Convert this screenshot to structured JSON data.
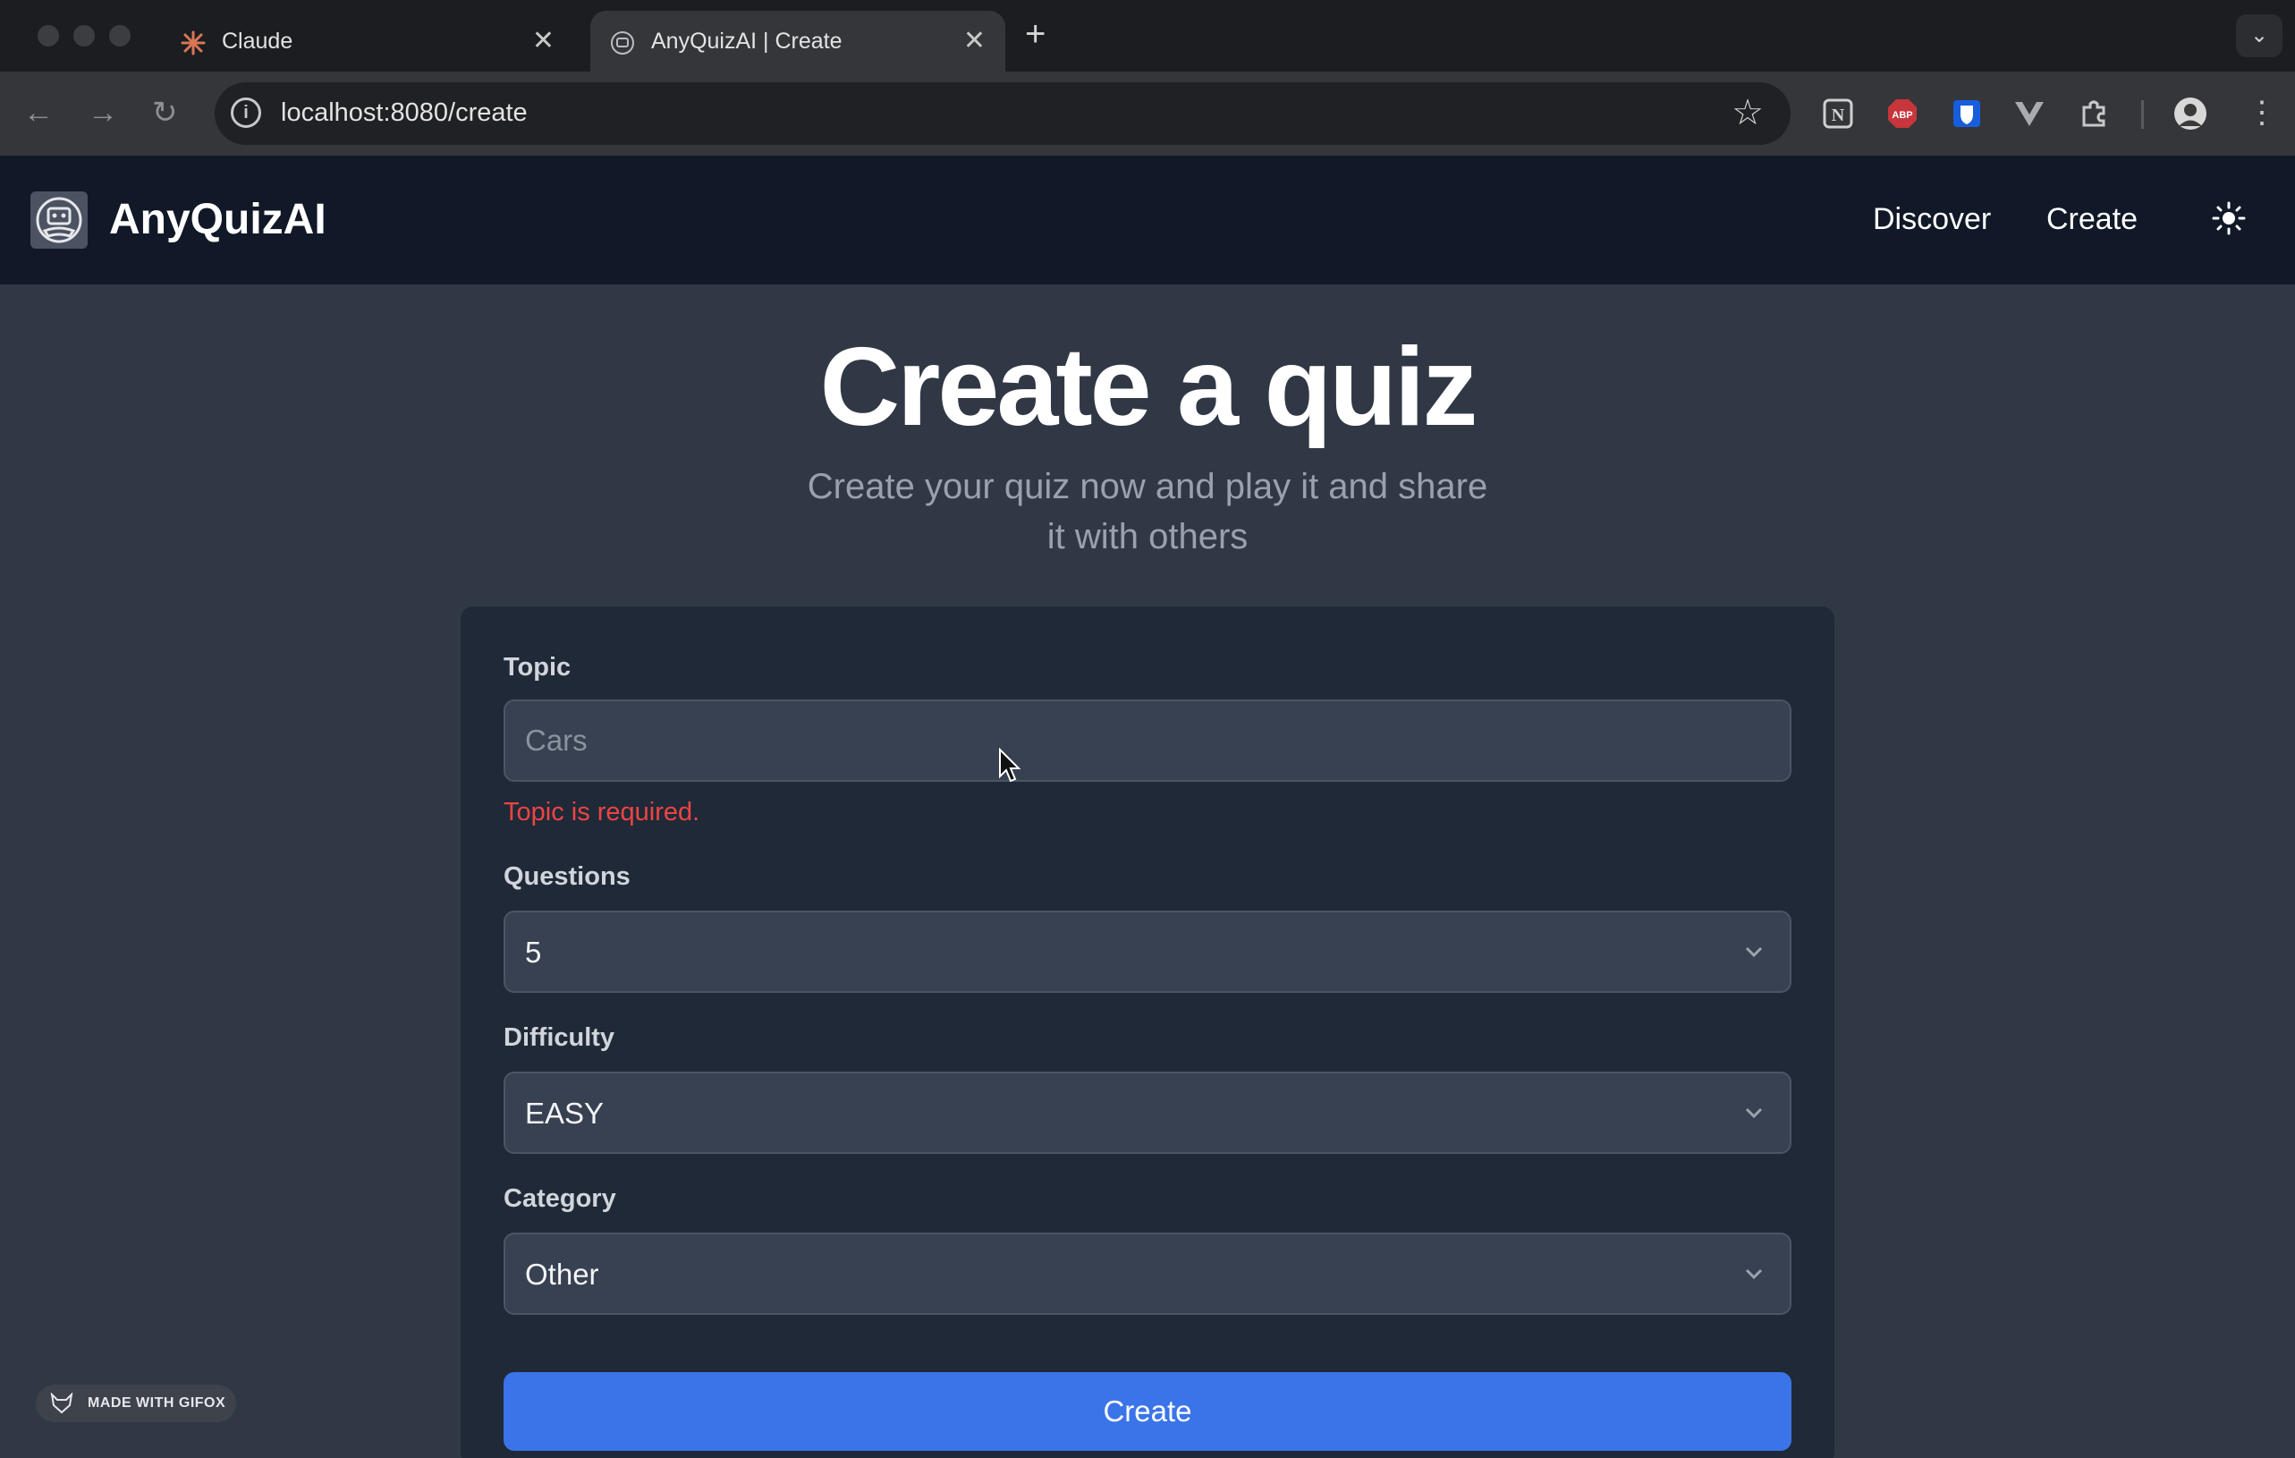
{
  "browser": {
    "tabs": [
      {
        "title": "Claude",
        "icon": "claude-sparkle-icon",
        "active": false
      },
      {
        "title": "AnyQuizAI | Create",
        "icon": "robot-favicon-icon",
        "active": true
      }
    ],
    "url": "localhost:8080/create",
    "extensions": [
      "notion-icon",
      "adblock-plus-icon",
      "bitwarden-icon",
      "vue-devtools-icon",
      "puzzle-extensions-icon"
    ],
    "colors": {
      "adblock": "#c6363c",
      "bitwarden": "#175ddc"
    }
  },
  "app": {
    "brand": "AnyQuizAI",
    "nav": {
      "discover": "Discover",
      "create": "Create"
    },
    "theme_toggle_icon": "sun-icon"
  },
  "page": {
    "title": "Create a quiz",
    "subtitle_line1": "Create your quiz now and play it and share",
    "subtitle_line2": "it with others"
  },
  "form": {
    "topic": {
      "label": "Topic",
      "placeholder": "Cars",
      "value": "",
      "error": "Topic is required."
    },
    "questions": {
      "label": "Questions",
      "selected": "5"
    },
    "difficulty": {
      "label": "Difficulty",
      "selected": "EASY"
    },
    "category": {
      "label": "Category",
      "selected": "Other"
    },
    "submit_label": "Create"
  },
  "badge": {
    "text": "MADE WITH GIFOX"
  },
  "colors": {
    "accent": "#3b74e8",
    "error": "#ef4444",
    "nav_bg": "#111827",
    "card_bg": "#1f2937"
  }
}
